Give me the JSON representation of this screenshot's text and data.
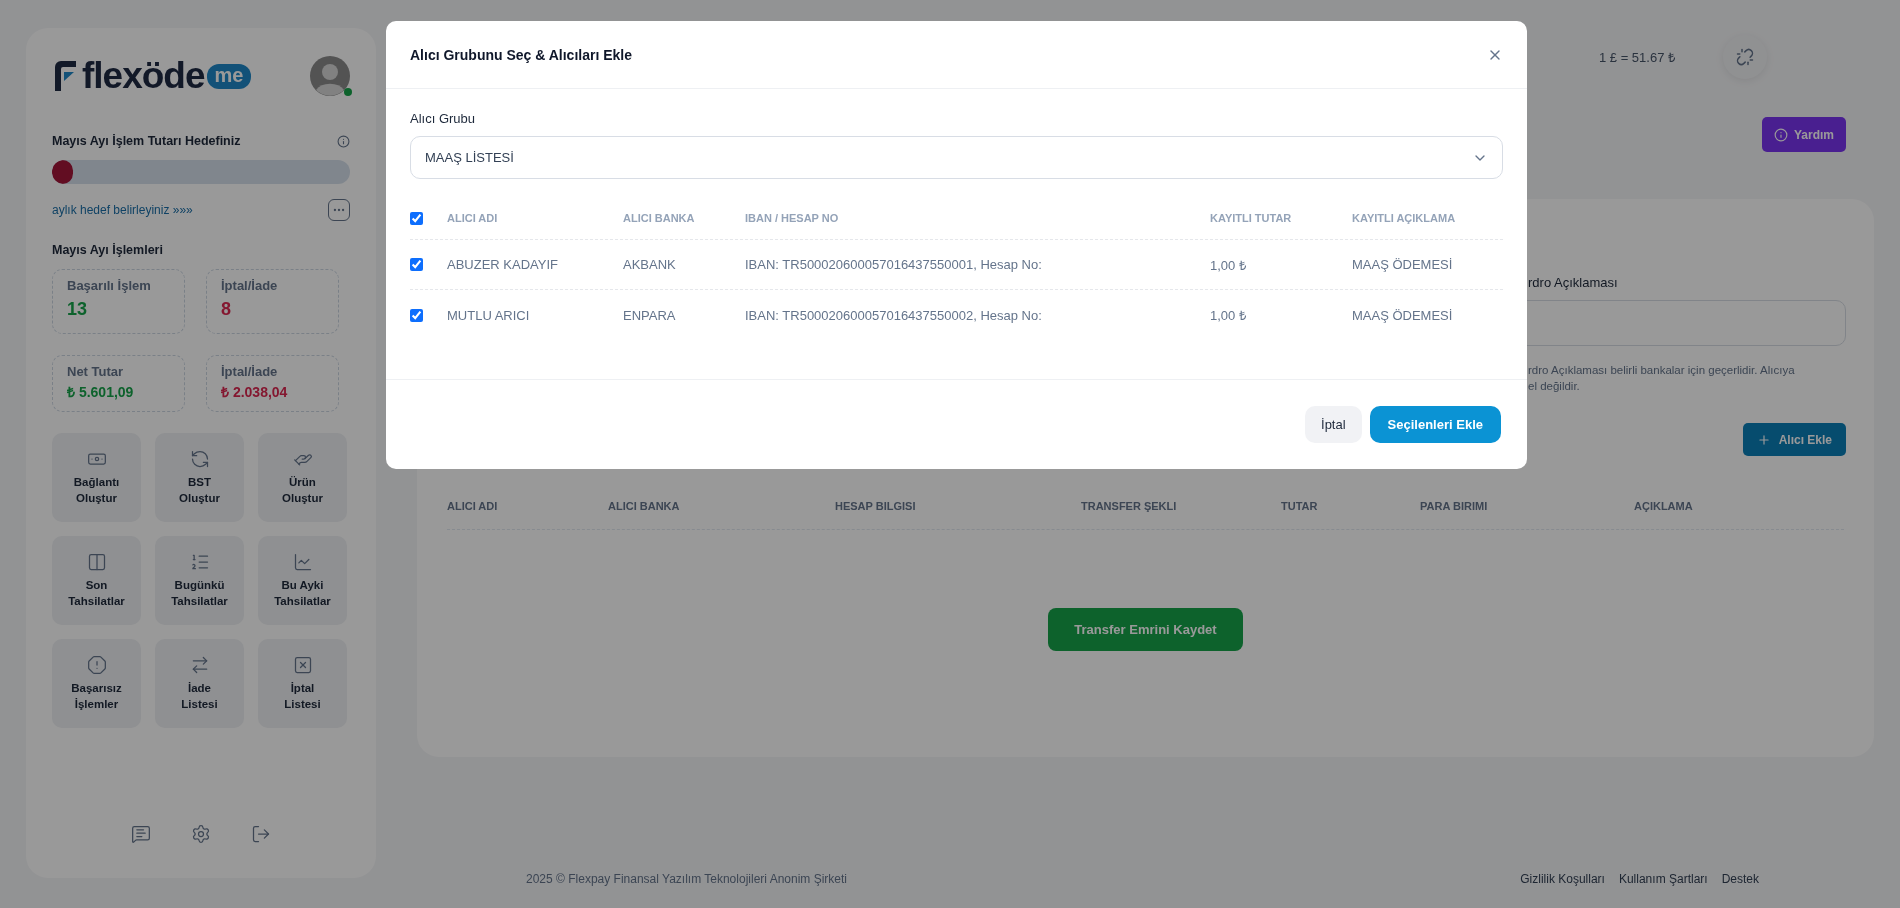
{
  "sidebar": {
    "logo": {
      "name": "flexöde",
      "suffix": "me"
    },
    "user": {
      "online": true
    },
    "goal": {
      "title": "Mayıs Ayı İşlem Tutarı Hedefiniz",
      "level": 0.07,
      "link": "aylık hedef belirleyiniz »»»"
    },
    "stats_title": "Mayıs Ayı İşlemleri",
    "stats": [
      {
        "label": "Başarılı İşlem",
        "value": "13",
        "color": "#0d622c"
      },
      {
        "label": "İptal/İade",
        "value": "8",
        "color": "#841730"
      },
      {
        "label": "Net Tutar",
        "value": "₺ 5.601,09",
        "color": "#0d622c"
      },
      {
        "label": "İptal/İade",
        "value": "₺ 2.038,04",
        "color": "#841730"
      }
    ],
    "tiles": [
      {
        "label": "Bağlantı\nOluştur"
      },
      {
        "label": "BST\nOluştur"
      },
      {
        "label": "Ürün\nOluştur"
      },
      {
        "label": "Son\nTahsilatlar"
      },
      {
        "label": "Bugünkü\nTahsilatlar"
      },
      {
        "label": "Bu Ayki\nTahsilatlar"
      },
      {
        "label": "Başarısız\nİşlemler"
      },
      {
        "label": "İade\nListesi"
      },
      {
        "label": "İptal\nListesi"
      }
    ]
  },
  "header": {
    "rate": "1 £ = 51.67 ₺",
    "help_button": "Yardım"
  },
  "form": {
    "label": "rdro Açıklaması",
    "help_lines": [
      "rdro Açıklaması belirli bankalar için geçerlidir. Alıcıya",
      "el değildir."
    ],
    "add_button": "Alıcı Ekle"
  },
  "transfers_table": {
    "columns": [
      "ALICI ADI",
      "ALICI BANKA",
      "HESAP BILGISI",
      "TRANSFER ŞEKLI",
      "TUTAR",
      "PARA BIRIMI",
      "AÇIKLAMA"
    ]
  },
  "save_button": "Transfer Emrini Kaydet",
  "footer": {
    "copyright": "2025 © Flexpay Finansal Yazılım Teknolojileri Anonim Şirketi",
    "links": [
      "Gizlilik Koşulları",
      "Kullanım Şartları",
      "Destek"
    ]
  },
  "dialog": {
    "title": "Alıcı Grubunu Seç & Alıcıları Ekle",
    "group_label": "Alıcı Grubu",
    "group_value": "MAAŞ LİSTESİ",
    "all_checked": true,
    "columns": [
      "ALICI ADI",
      "ALICI BANKA",
      "IBAN / HESAP NO",
      "KAYITLI TUTAR",
      "KAYITLI AÇIKLAMA"
    ],
    "rows": [
      {
        "checked": true,
        "cells": [
          "ABUZER KADAYIF",
          "AKBANK",
          "IBAN: TR500020600057016437550001, Hesap No:",
          "1,00 ₺",
          "MAAŞ ÖDEMESİ"
        ]
      },
      {
        "checked": true,
        "cells": [
          "MUTLU ARICI",
          "ENPARA",
          "IBAN: TR500020600057016437550002, Hesap No:",
          "1,00 ₺",
          "MAAŞ ÖDEMESİ"
        ]
      }
    ],
    "cancel_button": "İptal",
    "confirm_button": "Seçilenleri Ekle"
  }
}
